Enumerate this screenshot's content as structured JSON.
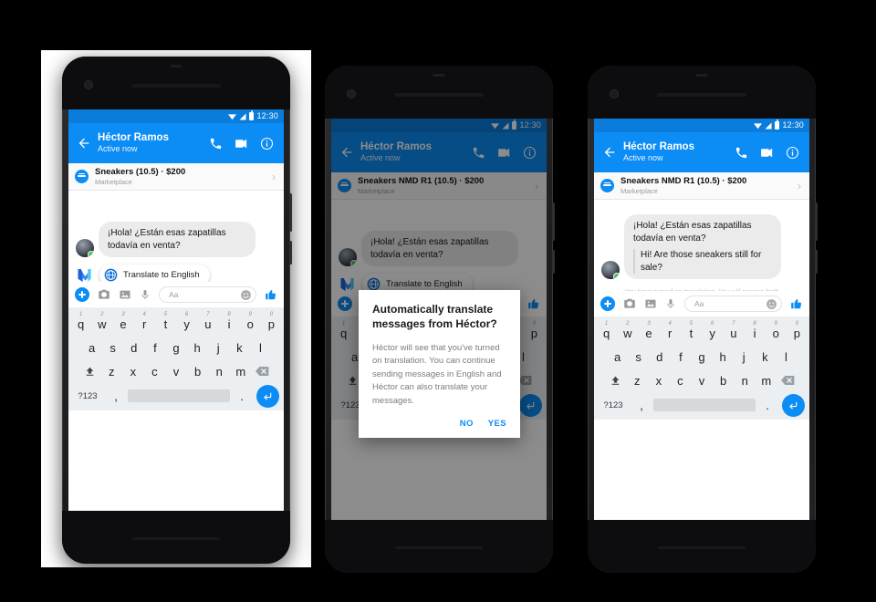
{
  "status_bar": {
    "time": "12:30",
    "icons": [
      "wifi-icon",
      "signal-icon",
      "battery-icon"
    ]
  },
  "app_bar": {
    "back_icon": "back-arrow-icon",
    "contact_name": "Héctor Ramos",
    "presence": "Active now",
    "actions": [
      "call-icon",
      "video-icon",
      "info-icon"
    ]
  },
  "marketplace": {
    "badge_icon": "marketplace-badge-icon",
    "title_short": "Sneakers (10.5) · $200",
    "title_long": "Sneakers NMD R1 (10.5) · $200",
    "subtitle": "Marketplace",
    "chevron": "›"
  },
  "messages": {
    "incoming_es": "¡Hola! ¿Están esas zapatillas todavía en venta?",
    "translated_en": "Hi! Are those sneakers still for sale?"
  },
  "translate_chip": {
    "icon": "globe-icon",
    "label": "Translate to English",
    "assistant_icon": "messenger-m-logo-icon"
  },
  "system_note": "You have turned on translation. You will receive both original and translated messages.",
  "composer": {
    "add_icon": "plus-circle-icon",
    "camera_icon": "camera-icon",
    "gallery_icon": "gallery-icon",
    "mic_icon": "microphone-icon",
    "input_placeholder": "Aa",
    "emoji_icon": "emoji-smiley-icon",
    "like_icon": "thumbs-up-icon"
  },
  "keyboard": {
    "row1": [
      {
        "k": "q",
        "n": "1"
      },
      {
        "k": "w",
        "n": "2"
      },
      {
        "k": "e",
        "n": "3"
      },
      {
        "k": "r",
        "n": "4"
      },
      {
        "k": "t",
        "n": "5"
      },
      {
        "k": "y",
        "n": "6"
      },
      {
        "k": "u",
        "n": "7"
      },
      {
        "k": "i",
        "n": "8"
      },
      {
        "k": "o",
        "n": "9"
      },
      {
        "k": "p",
        "n": "0"
      }
    ],
    "row2": [
      "a",
      "s",
      "d",
      "f",
      "g",
      "h",
      "j",
      "k",
      "l"
    ],
    "row3": [
      "z",
      "x",
      "c",
      "v",
      "b",
      "n",
      "m"
    ],
    "shift_icon": "shift-key-icon",
    "delete_icon": "backspace-key-icon",
    "symbols_label": "?123",
    "comma": ",",
    "period": ".",
    "enter_icon": "enter-key-icon"
  },
  "nav_bar": {
    "back_icon": "nav-back-triangle-icon",
    "home_icon": "nav-home-circle-icon",
    "recents_icon": "nav-recents-square-icon"
  },
  "dialog": {
    "title": "Automatically translate messages from Héctor?",
    "body": "Héctor will see that you've turned on translation. You can continue sending messages in English and Héctor can also translate your messages.",
    "no_label": "NO",
    "yes_label": "YES"
  },
  "colors": {
    "messenger_blue": "#0c8cf5",
    "status_bar_blue": "#0a7cdb",
    "bubble_gray": "#ebebeb",
    "keyboard_bg": "#eceff1",
    "online_green": "#40c351",
    "page_bg": "#000000"
  }
}
